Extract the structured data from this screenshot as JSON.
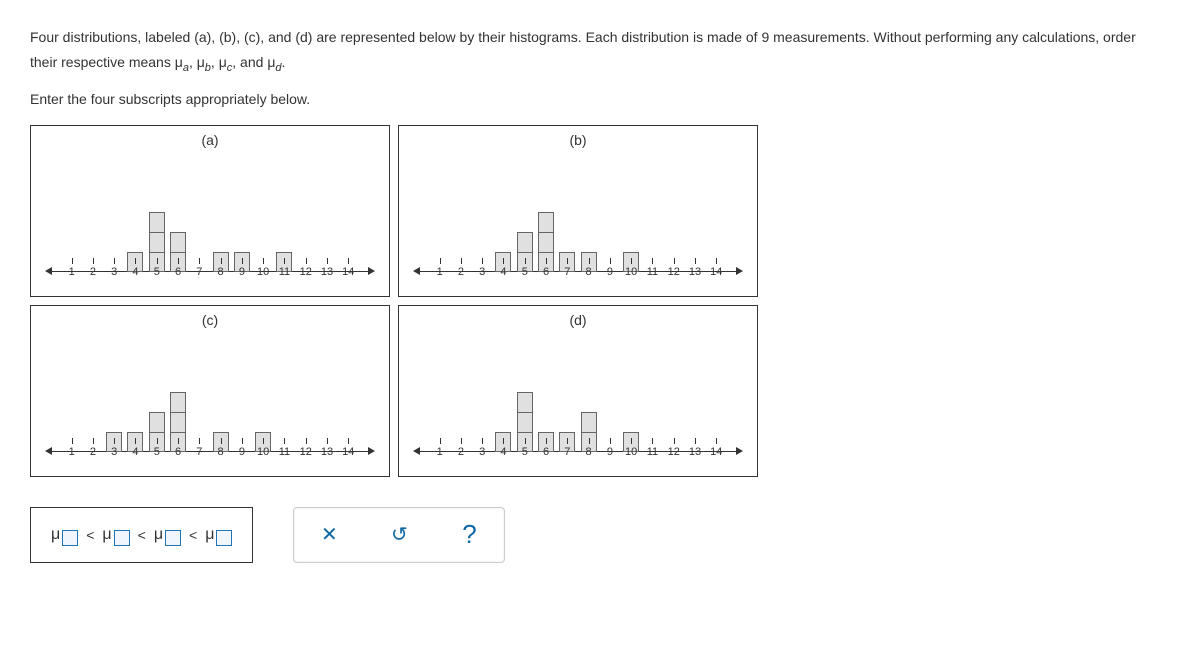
{
  "instructions": {
    "line1_pre": "Four distributions, labeled (a), (b), (c), and (d) are represented below by their histograms. Each distribution is made of 9 measurements. Without performing any calculations, order their respective means ",
    "mu_a": "μ",
    "sub_a": "a",
    "sep1": ", ",
    "mu_b": "μ",
    "sub_b": "b",
    "sep2": ", ",
    "mu_c": "μ",
    "sub_c": "c",
    "sep3": ", and ",
    "mu_d": "μ",
    "sub_d": "d",
    "period": ".",
    "line2": "Enter the four subscripts appropriately below."
  },
  "chart_data": [
    {
      "id": "a",
      "label": "(a)",
      "type": "bar",
      "categories": [
        1,
        2,
        3,
        4,
        5,
        6,
        7,
        8,
        9,
        10,
        11,
        12,
        13,
        14
      ],
      "values": [
        0,
        0,
        0,
        1,
        3,
        2,
        0,
        1,
        1,
        0,
        1,
        0,
        0,
        0
      ]
    },
    {
      "id": "b",
      "label": "(b)",
      "type": "bar",
      "categories": [
        1,
        2,
        3,
        4,
        5,
        6,
        7,
        8,
        9,
        10,
        11,
        12,
        13,
        14
      ],
      "values": [
        0,
        0,
        0,
        1,
        2,
        3,
        1,
        1,
        0,
        1,
        0,
        0,
        0,
        0
      ]
    },
    {
      "id": "c",
      "label": "(c)",
      "type": "bar",
      "categories": [
        1,
        2,
        3,
        4,
        5,
        6,
        7,
        8,
        9,
        10,
        11,
        12,
        13,
        14
      ],
      "values": [
        0,
        0,
        1,
        1,
        2,
        3,
        0,
        1,
        0,
        1,
        0,
        0,
        0,
        0
      ]
    },
    {
      "id": "d",
      "label": "(d)",
      "type": "bar",
      "categories": [
        1,
        2,
        3,
        4,
        5,
        6,
        7,
        8,
        9,
        10,
        11,
        12,
        13,
        14
      ],
      "values": [
        0,
        0,
        0,
        1,
        3,
        1,
        1,
        2,
        0,
        1,
        0,
        0,
        0,
        0
      ]
    }
  ],
  "answer": {
    "mu": "μ",
    "lt": "<"
  },
  "controls": {
    "clear": "✕",
    "reset": "↺",
    "help": "?"
  }
}
